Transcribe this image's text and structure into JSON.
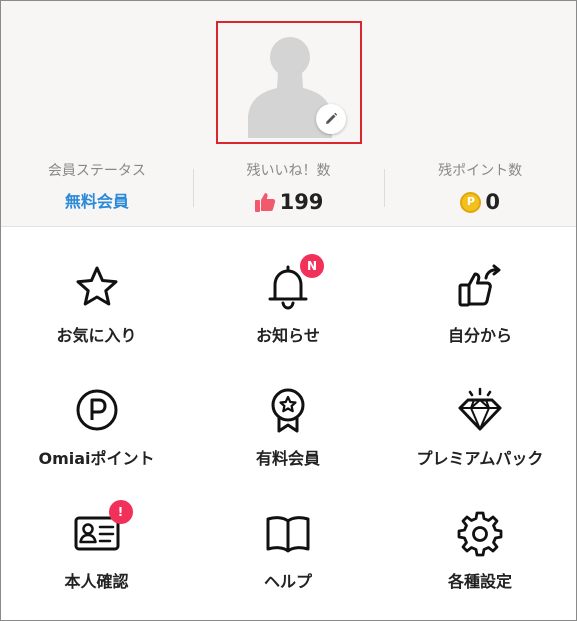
{
  "profile": {
    "avatar_icon": "default-person-silhouette",
    "edit_icon": "pencil-icon"
  },
  "stats": [
    {
      "label": "会員ステータス",
      "value": "無料会員"
    },
    {
      "label": "残いいね！数",
      "value": "199",
      "icon": "thumbs-up-icon"
    },
    {
      "label": "残ポイント数",
      "value": "0",
      "icon": "coin-icon",
      "icon_text": "P"
    }
  ],
  "menu": [
    {
      "label": "お気に入り",
      "icon": "star-icon"
    },
    {
      "label": "お知らせ",
      "icon": "bell-icon",
      "badge": "N"
    },
    {
      "label": "自分から",
      "icon": "thumbs-up-arrow-icon"
    },
    {
      "label": "Omiaiポイント",
      "icon": "point-circle-icon"
    },
    {
      "label": "有料会員",
      "icon": "award-badge-icon"
    },
    {
      "label": "プレミアムパック",
      "icon": "diamond-icon"
    },
    {
      "label": "本人確認",
      "icon": "id-card-icon",
      "badge": "!"
    },
    {
      "label": "ヘルプ",
      "icon": "open-book-icon"
    },
    {
      "label": "各種設定",
      "icon": "gear-icon"
    }
  ],
  "colors": {
    "accent_blue": "#2b8ad8",
    "badge_red": "#f2315b",
    "highlight_border": "#d9262f",
    "thumb_red": "#f15a6c",
    "coin_gold": "#f3c11b"
  }
}
